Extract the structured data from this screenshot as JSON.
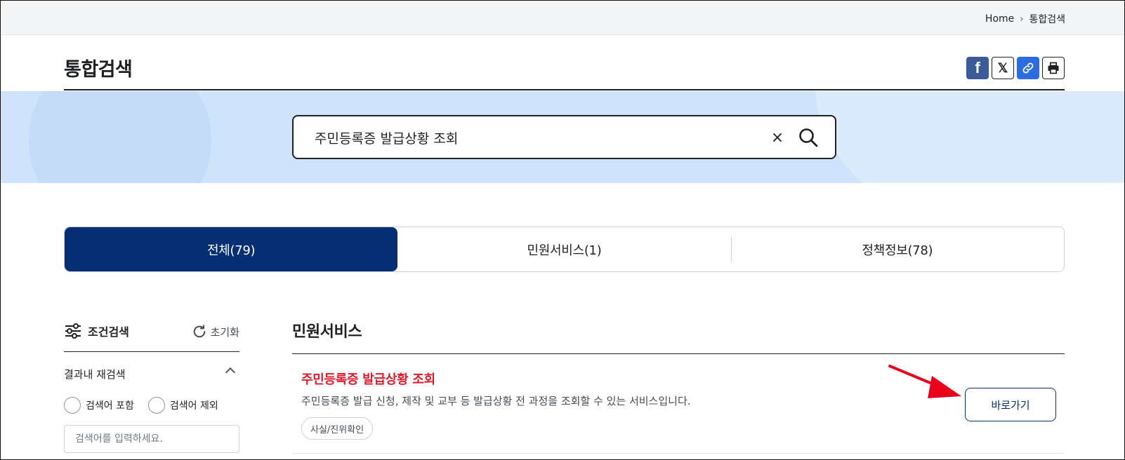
{
  "breadcrumb": {
    "home": "Home",
    "current": "통합검색"
  },
  "page": {
    "title": "통합검색"
  },
  "share": {
    "facebook_icon": "facebook-icon",
    "x_icon": "x-icon",
    "link_icon": "link-icon",
    "print_icon": "print-icon",
    "facebook_glyph": "f",
    "x_glyph": "𝕏"
  },
  "search": {
    "value": "주민등록증 발급상황 조회",
    "clear_glyph": "×"
  },
  "tabs": [
    {
      "label": "전체(79)",
      "active": true
    },
    {
      "label": "민원서비스(1)",
      "active": false
    },
    {
      "label": "정책정보(78)",
      "active": false
    }
  ],
  "filter": {
    "title": "조건검색",
    "reset": "초기화",
    "refine_label": "결과내 재검색",
    "radio_include": "검색어 포함",
    "radio_exclude": "검색어 제외",
    "input_placeholder": "검색어를 입력하세요."
  },
  "results": {
    "section_title": "민원서비스",
    "items": [
      {
        "title": "주민등록증 발급상황 조회",
        "description": "주민등록증 발급 신청, 제작 및 교부 등 발급상황 전 과정을 조회할 수 있는 서비스입니다.",
        "tag": "사실/진위확인",
        "button": "바로가기"
      }
    ]
  },
  "colors": {
    "primary": "#052f72",
    "highlight": "#de1b2b",
    "hero_bg": "#cfe4fb",
    "annotation_arrow": "#e8001c"
  }
}
